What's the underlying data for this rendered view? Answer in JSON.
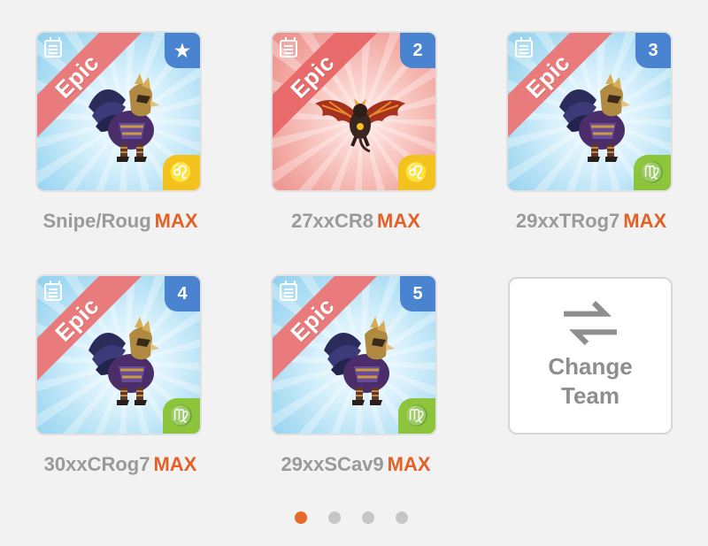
{
  "team": [
    {
      "ribbon": "Epic",
      "badge": "★",
      "sign": "♌",
      "sign_name": "leo",
      "theme": "blue",
      "name": "Snipe/Roug",
      "level": "MAX",
      "creature": "griffin-icon"
    },
    {
      "ribbon": "Epic",
      "badge": "2",
      "sign": "♌",
      "sign_name": "leo",
      "theme": "red",
      "name": "27xxCR8",
      "level": "MAX",
      "creature": "dragon-icon"
    },
    {
      "ribbon": "Epic",
      "badge": "3",
      "sign": "♍",
      "sign_name": "virgo",
      "theme": "blue",
      "name": "29xxTRog7",
      "level": "MAX",
      "creature": "griffin-icon"
    },
    {
      "ribbon": "Epic",
      "badge": "4",
      "sign": "♍",
      "sign_name": "virgo",
      "theme": "blue",
      "name": "30xxCRog7",
      "level": "MAX",
      "creature": "griffin-icon"
    },
    {
      "ribbon": "Epic",
      "badge": "5",
      "sign": "♍",
      "sign_name": "virgo",
      "theme": "blue",
      "name": "29xxSCav9",
      "level": "MAX",
      "creature": "griffin-icon"
    }
  ],
  "change_team": {
    "line1": "Change",
    "line2": "Team",
    "icon": "swap-arrows-icon"
  },
  "pagination": {
    "count": 4,
    "active": 1
  },
  "colors": {
    "accent": "#e36126",
    "epic": "#ea7b7c",
    "badge": "#4a84d0",
    "leo": "#f3c21c",
    "virgo": "#8cc43b"
  }
}
